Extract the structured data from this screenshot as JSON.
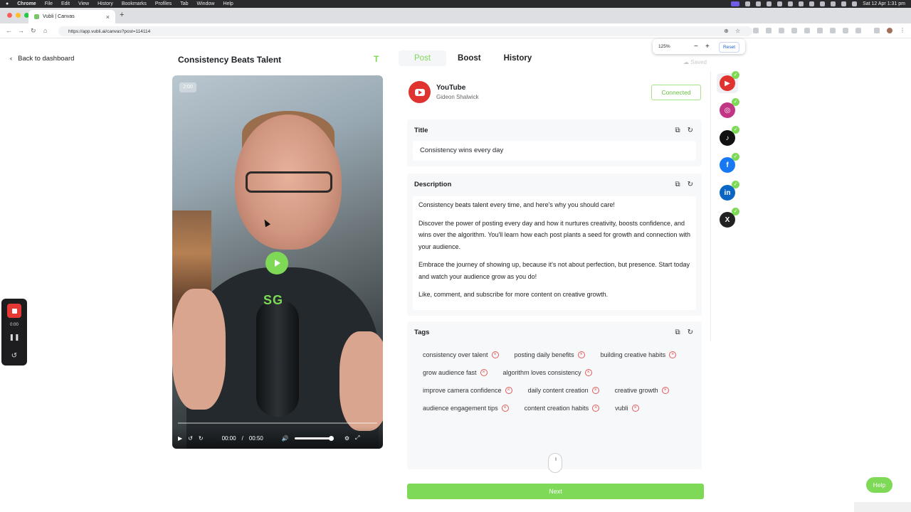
{
  "menubar": {
    "app": "Chrome",
    "items": [
      "File",
      "Edit",
      "View",
      "History",
      "Bookmarks",
      "Profiles",
      "Tab",
      "Window",
      "Help"
    ],
    "clock": "Sat 12 Apr  1:31 pm"
  },
  "browser": {
    "tab_title": "Vubli | Canvas",
    "url": "https://app.vubli.ai/canvas?post=114114",
    "zoom_value": "125%",
    "zoom_reset": "Reset"
  },
  "header": {
    "back_label": "Back to dashboard",
    "page_title": "Consistency Beats Talent",
    "t_icon": "T",
    "tabs": [
      {
        "label": "Post"
      },
      {
        "label": "Boost"
      },
      {
        "label": "History"
      }
    ],
    "saved_label": "Saved"
  },
  "video": {
    "duration_badge": "2:00",
    "overlay_text": "SG",
    "time_current": "00:00",
    "time_separator": "/",
    "time_total": "00:50",
    "volume_level": 0.95
  },
  "recorder": {
    "time": "0:00"
  },
  "platform": {
    "name": "YouTube",
    "user": "Gideon Shalwick",
    "status": "Connected"
  },
  "title_section": {
    "heading": "Title",
    "value": "Consistency wins every day"
  },
  "description_section": {
    "heading": "Description",
    "paragraphs": [
      "Consistency beats talent every time, and here's why you should care!",
      "Discover the power of posting every day and how it nurtures creativity, boosts confidence, and wins over the algorithm. You'll learn how each post plants a seed for growth and connection with your audience.",
      "Embrace the journey of showing up, because it's not about perfection, but presence. Start today and watch your audience grow as you do!",
      "Like, comment, and subscribe for more content on creative growth."
    ]
  },
  "tags_section": {
    "heading": "Tags",
    "tags": [
      "consistency over talent",
      "posting daily benefits",
      "building creative habits",
      "grow audience fast",
      "algorithm loves consistency",
      "improve camera confidence",
      "daily content creation",
      "creative growth",
      "audience engagement tips",
      "content creation habits",
      "vubli"
    ]
  },
  "actions": {
    "next_label": "Next",
    "help_label": "Help"
  },
  "colors": {
    "accent": "#7ed957",
    "youtube": "#e0332f",
    "remove": "#e35b5b"
  },
  "social_sidebar": [
    {
      "name": "youtube-icon",
      "color": "#e0332f"
    },
    {
      "name": "instagram-icon",
      "color": "#c13584"
    },
    {
      "name": "tiktok-icon",
      "color": "#111111"
    },
    {
      "name": "facebook-icon",
      "color": "#1877f2"
    },
    {
      "name": "linkedin-icon",
      "color": "#0a66c2"
    },
    {
      "name": "x-icon",
      "color": "#222222"
    }
  ]
}
